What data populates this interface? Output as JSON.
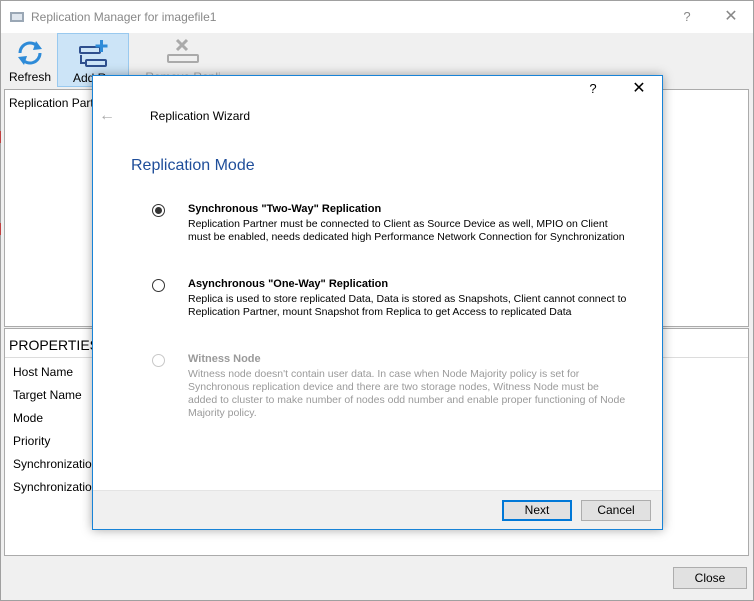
{
  "window": {
    "title": "Replication Manager for imagefile1",
    "help_glyph": "?",
    "close_glyph": "✕"
  },
  "toolbar": {
    "refresh_label": "Refresh",
    "add_label": "Add Re",
    "remove_label": "Remove Repli"
  },
  "partners": {
    "header": "Replication Partn"
  },
  "properties": {
    "title": "PROPERTIES",
    "rows": [
      "Host Name",
      "Target Name",
      "Mode",
      "Priority",
      "Synchronization",
      "Synchronization"
    ]
  },
  "footer": {
    "close_label": "Close"
  },
  "wizard": {
    "help_glyph": "?",
    "close_glyph": "✕",
    "back_glyph": "←",
    "title": "Replication Wizard",
    "heading": "Replication Mode",
    "options": [
      {
        "title": "Synchronous \"Two-Way\" Replication",
        "description": "Replication Partner must be connected to Client as Source Device as well, MPIO on Client must be enabled, needs dedicated high Performance Network Connection for Synchronization",
        "selected": true,
        "enabled": true
      },
      {
        "title": "Asynchronous \"One-Way\" Replication",
        "description": "Replica is used to store replicated Data, Data is stored as Snapshots, Client cannot connect to Replication Partner, mount Snapshot from Replica to get Access to replicated Data",
        "selected": false,
        "enabled": true
      },
      {
        "title": "Witness Node",
        "description": "Witness node doesn't contain user data. In case when Node Majority policy is set for Synchronous replication device and there are two storage nodes, Witness Node must be added to cluster to make number of nodes odd number and enable proper functioning of Node Majority policy.",
        "selected": false,
        "enabled": false
      }
    ],
    "next_label": "Next",
    "cancel_label": "Cancel"
  },
  "colors": {
    "accent": "#1883d7",
    "heading": "#1f4e9a",
    "toolbar_active": "#cce4f7"
  }
}
